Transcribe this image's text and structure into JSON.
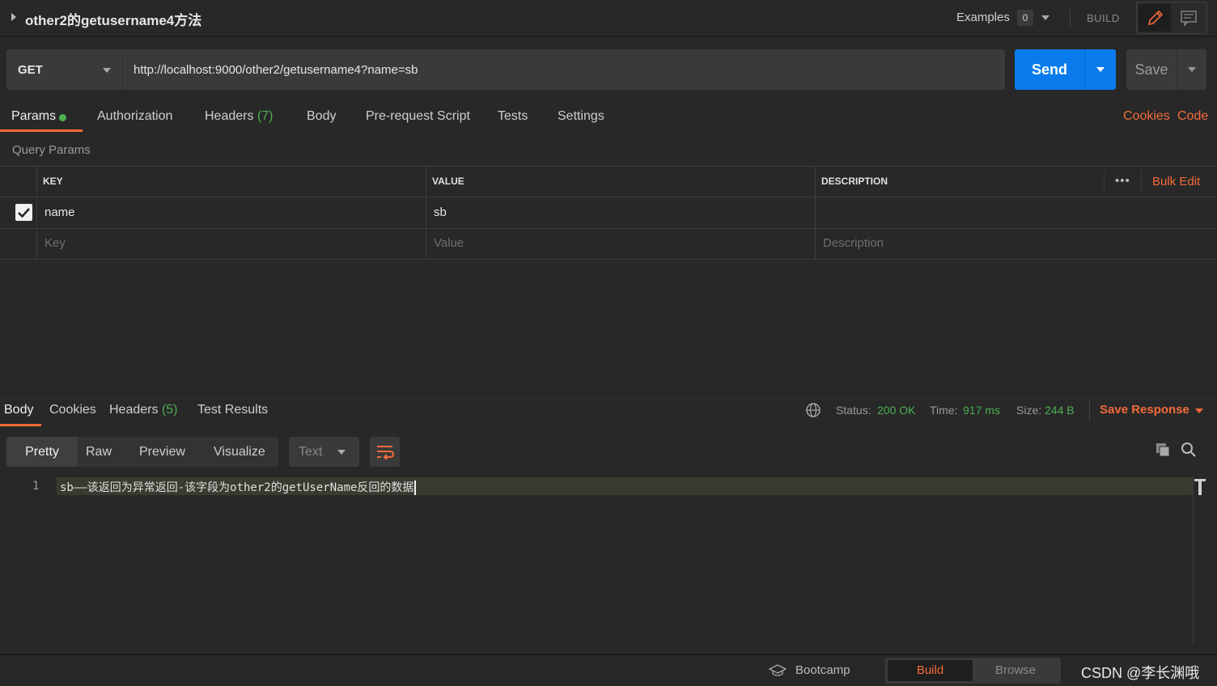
{
  "title_bar": {
    "request_name": "other2的getusername4方法",
    "examples_label": "Examples",
    "examples_count": "0",
    "build_label": "BUILD"
  },
  "request": {
    "method": "GET",
    "url": "http://localhost:9000/other2/getusername4?name=sb",
    "send_label": "Send",
    "save_label": "Save"
  },
  "request_tabs": {
    "params": "Params",
    "authorization": "Authorization",
    "headers": "Headers",
    "headers_count": "(7)",
    "body": "Body",
    "prerequest": "Pre-request Script",
    "tests": "Tests",
    "settings": "Settings",
    "cookies": "Cookies",
    "code": "Code"
  },
  "query_params": {
    "label": "Query Params",
    "columns": {
      "key": "KEY",
      "value": "VALUE",
      "description": "DESCRIPTION"
    },
    "more": "•••",
    "bulk_edit": "Bulk Edit",
    "rows": [
      {
        "checked": true,
        "key": "name",
        "value": "sb",
        "description": ""
      }
    ],
    "placeholders": {
      "key": "Key",
      "value": "Value",
      "description": "Description"
    }
  },
  "response_tabs": {
    "body": "Body",
    "cookies": "Cookies",
    "headers": "Headers",
    "headers_count": "(5)",
    "test_results": "Test Results"
  },
  "response_meta": {
    "status_label": "Status:",
    "status_value": "200 OK",
    "time_label": "Time:",
    "time_value": "917 ms",
    "size_label": "Size:",
    "size_value": "244 B",
    "save_response": "Save Response"
  },
  "view_modes": {
    "pretty": "Pretty",
    "raw": "Raw",
    "preview": "Preview",
    "visualize": "Visualize",
    "format": "Text"
  },
  "editor": {
    "line_number": "1",
    "content": "sb——该返回为异常返回-该字段为other2的getUserName反回的数据"
  },
  "footer": {
    "bootcamp": "Bootcamp",
    "build": "Build",
    "browse": "Browse",
    "watermark": "CSDN @李长渊哦"
  },
  "colors": {
    "accent": "#f26b3a",
    "send": "#097bed",
    "success": "#4caf50",
    "background": "#282828"
  }
}
